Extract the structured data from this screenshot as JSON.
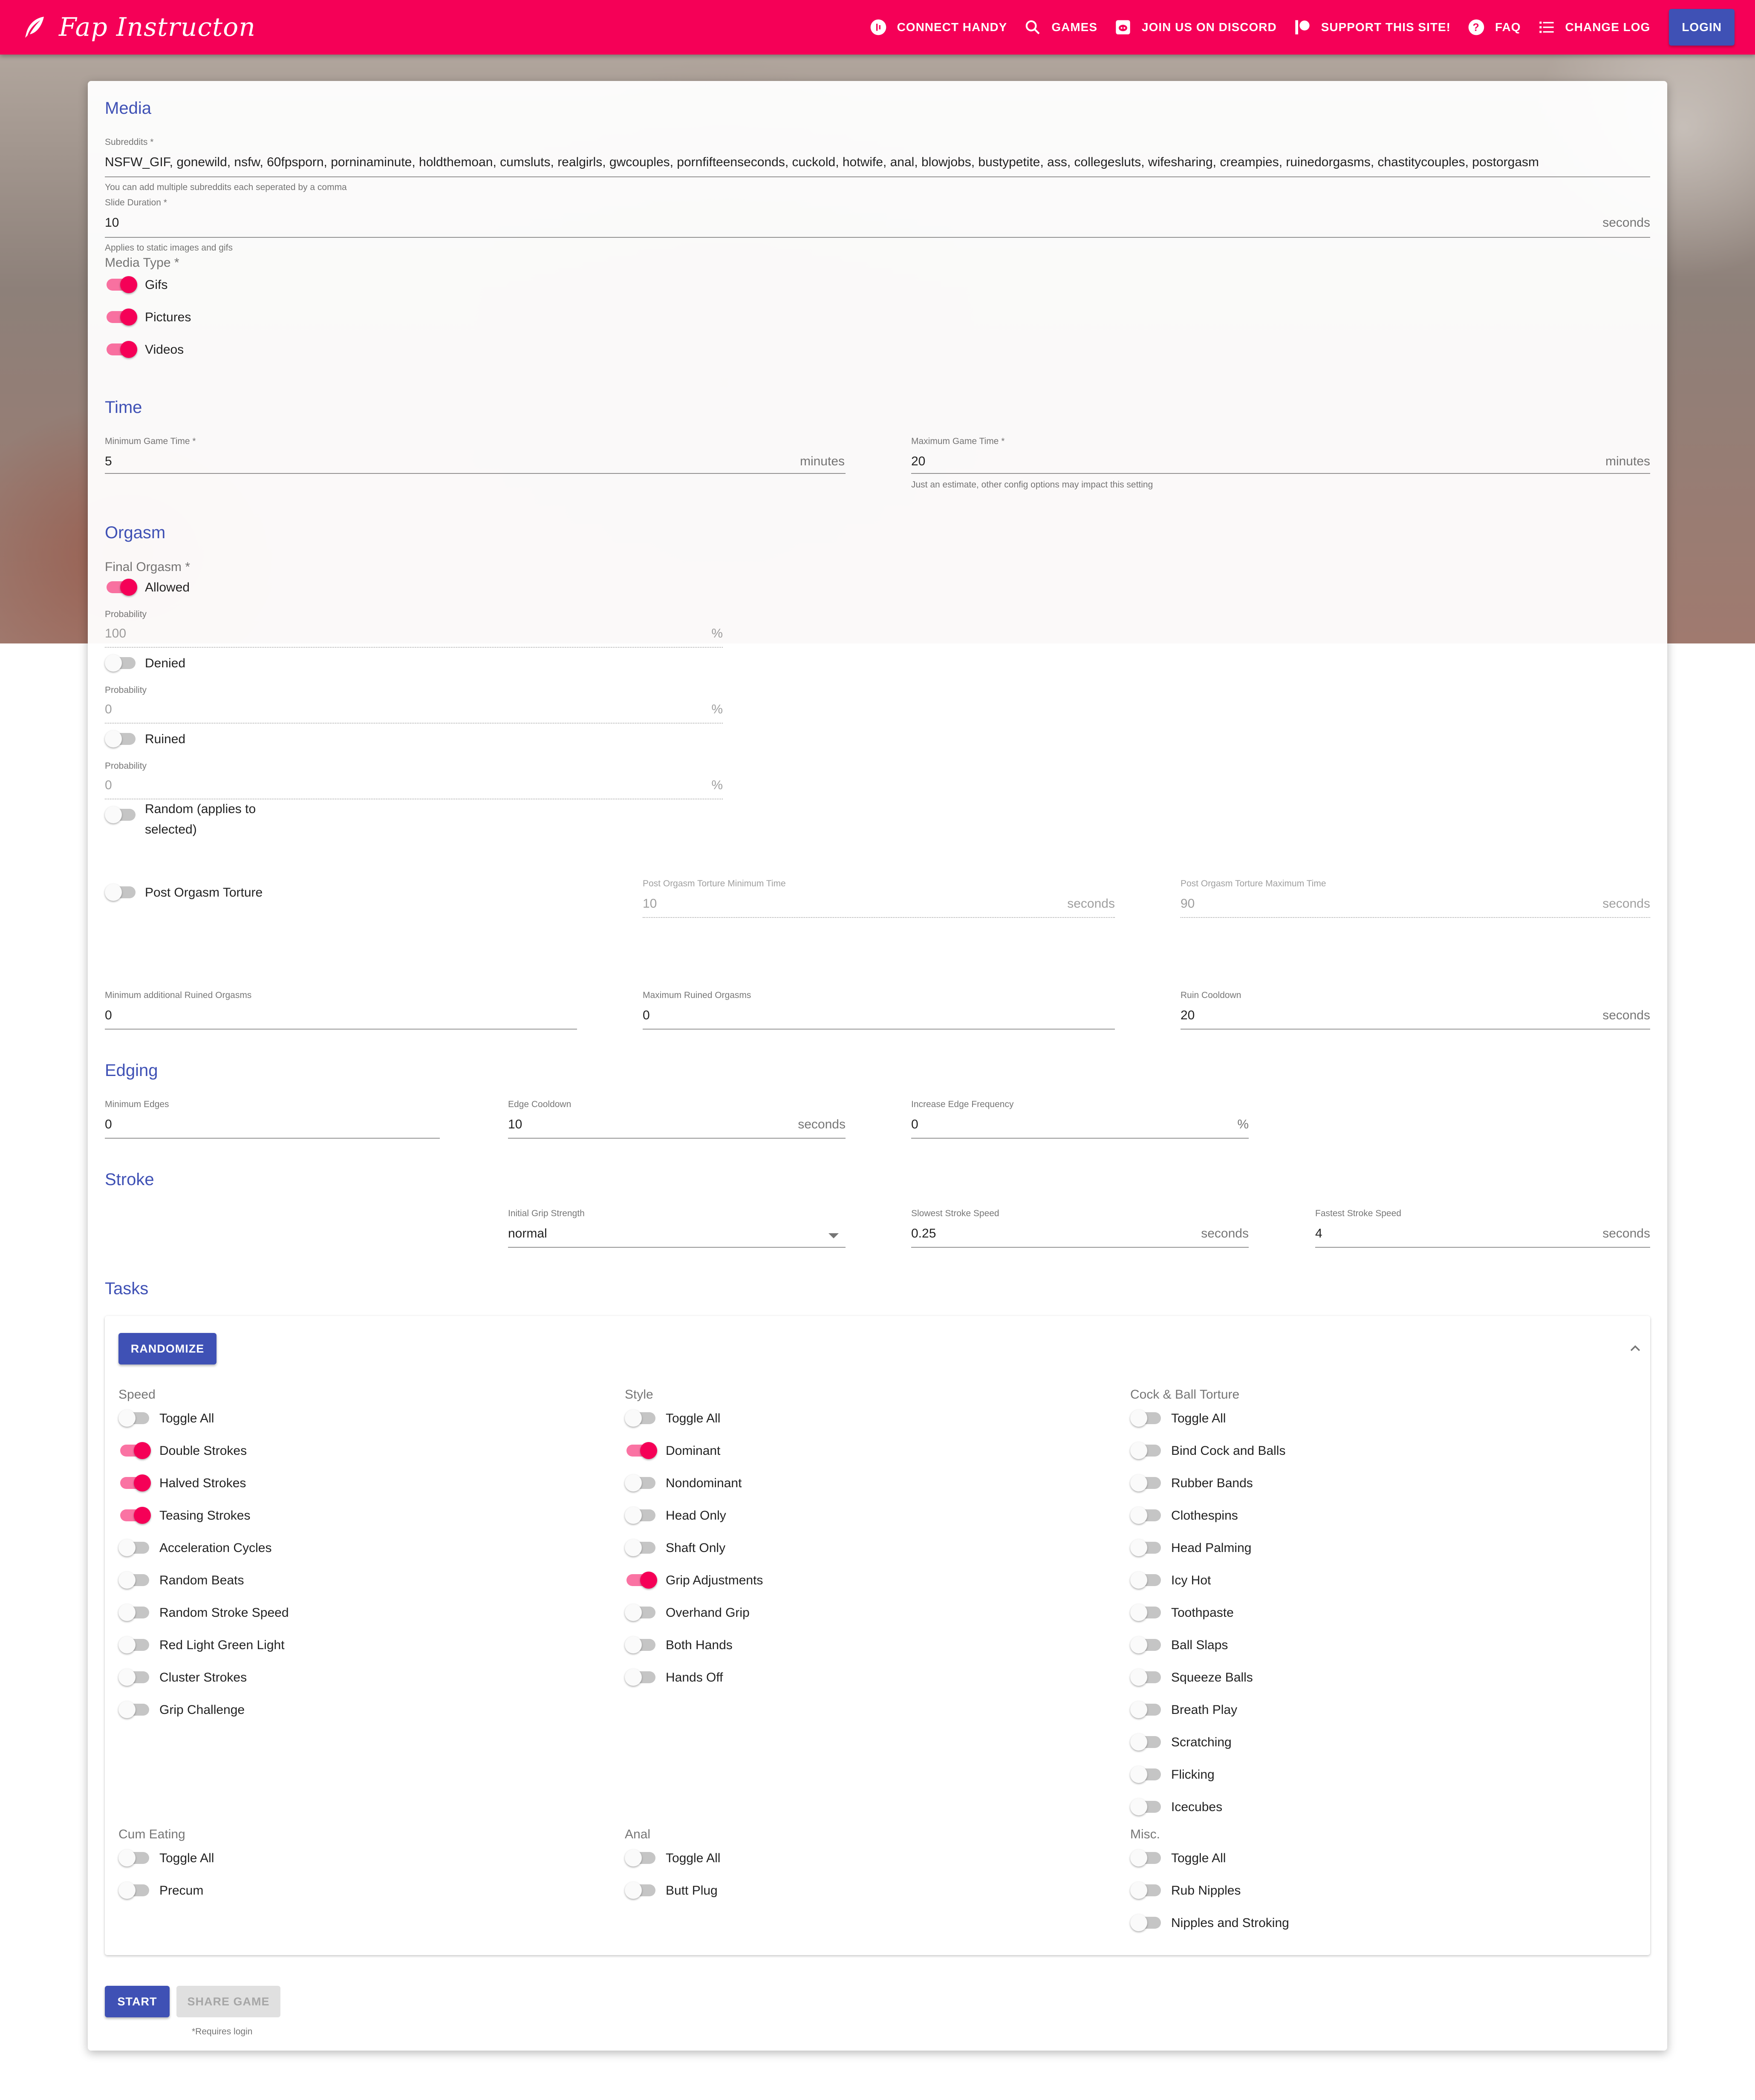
{
  "header": {
    "app_title": "Fap Instructon",
    "nav": [
      {
        "label": "CONNECT HANDY",
        "icon": "handy-icon"
      },
      {
        "label": "GAMES",
        "icon": "search-icon"
      },
      {
        "label": "JOIN US ON DISCORD",
        "icon": "discord-icon"
      },
      {
        "label": "SUPPORT THIS SITE!",
        "icon": "patreon-icon"
      },
      {
        "label": "FAQ",
        "icon": "help-icon"
      },
      {
        "label": "CHANGE LOG",
        "icon": "list-icon"
      }
    ],
    "login_label": "LOGIN"
  },
  "colors": {
    "primary": "#3f51b5",
    "accent": "#f50057"
  },
  "media": {
    "title": "Media",
    "subreddits_label": "Subreddits *",
    "subreddits_value": "NSFW_GIF, gonewild, nsfw, 60fpsporn, porninaminute, holdthemoan, cumsluts, realgirls, gwcouples, pornfifteenseconds, cuckold, hotwife, anal, blowjobs, bustypetite, ass, collegesluts, wifesharing, creampies, ruinedorgasms, chastitycouples, postorgasm",
    "subreddits_helper": "You can add multiple subreddits each seperated by a comma",
    "slide_label": "Slide Duration *",
    "slide_value": "10",
    "slide_unit": "seconds",
    "slide_helper": "Applies to static images and gifs",
    "type_label": "Media Type *",
    "types": [
      {
        "label": "Gifs",
        "on": true
      },
      {
        "label": "Pictures",
        "on": true
      },
      {
        "label": "Videos",
        "on": true
      }
    ]
  },
  "time": {
    "title": "Time",
    "min_label": "Minimum Game Time *",
    "min_value": "5",
    "min_unit": "minutes",
    "max_label": "Maximum Game Time *",
    "max_value": "20",
    "max_unit": "minutes",
    "max_helper": "Just an estimate, other config options may impact this setting"
  },
  "orgasm": {
    "title": "Orgasm",
    "final_label": "Final Orgasm *",
    "allowed_label": "Allowed",
    "allowed_on": true,
    "probability_label": "Probability",
    "allowed_prob": "100",
    "percent": "%",
    "denied_label": "Denied",
    "denied_on": false,
    "denied_prob": "0",
    "ruined_label": "Ruined",
    "ruined_on": false,
    "ruined_prob": "0",
    "random_label_1": "Random (applies to",
    "random_label_2": "selected)",
    "random_on": false,
    "pot_label": "Post Orgasm Torture",
    "pot_on": false,
    "pot_min_label": "Post Orgasm Torture Minimum Time",
    "pot_min_value": "10",
    "pot_min_unit": "seconds",
    "pot_max_label": "Post Orgasm Torture Maximum Time",
    "pot_max_value": "90",
    "pot_max_unit": "seconds",
    "min_ruined_label": "Minimum additional Ruined Orgasms",
    "min_ruined_value": "0",
    "max_ruined_label": "Maximum Ruined Orgasms",
    "max_ruined_value": "0",
    "ruin_cd_label": "Ruin Cooldown",
    "ruin_cd_value": "20",
    "ruin_cd_unit": "seconds"
  },
  "edging": {
    "title": "Edging",
    "min_label": "Minimum Edges",
    "min_value": "0",
    "cd_label": "Edge Cooldown",
    "cd_value": "10",
    "cd_unit": "seconds",
    "freq_label": "Increase Edge Frequency",
    "freq_value": "0",
    "freq_unit": "%"
  },
  "stroke": {
    "title": "Stroke",
    "grip_label": "Initial Grip Strength",
    "grip_value": "normal",
    "slow_label": "Slowest Stroke Speed",
    "slow_value": "0.25",
    "slow_unit": "seconds",
    "fast_label": "Fastest Stroke Speed",
    "fast_value": "4",
    "fast_unit": "seconds"
  },
  "tasks": {
    "title": "Tasks",
    "randomize_label": "RANDOMIZE",
    "groups": [
      {
        "title": "Speed",
        "items": [
          {
            "label": "Toggle All",
            "on": false
          },
          {
            "label": "Double Strokes",
            "on": true
          },
          {
            "label": "Halved Strokes",
            "on": true
          },
          {
            "label": "Teasing Strokes",
            "on": true
          },
          {
            "label": "Acceleration Cycles",
            "on": false
          },
          {
            "label": "Random Beats",
            "on": false
          },
          {
            "label": "Random Stroke Speed",
            "on": false
          },
          {
            "label": "Red Light Green Light",
            "on": false
          },
          {
            "label": "Cluster Strokes",
            "on": false
          },
          {
            "label": "Grip Challenge",
            "on": false
          }
        ]
      },
      {
        "title": "Style",
        "items": [
          {
            "label": "Toggle All",
            "on": false
          },
          {
            "label": "Dominant",
            "on": true
          },
          {
            "label": "Nondominant",
            "on": false
          },
          {
            "label": "Head Only",
            "on": false
          },
          {
            "label": "Shaft Only",
            "on": false
          },
          {
            "label": "Grip Adjustments",
            "on": true
          },
          {
            "label": "Overhand Grip",
            "on": false
          },
          {
            "label": "Both Hands",
            "on": false
          },
          {
            "label": "Hands Off",
            "on": false
          }
        ]
      },
      {
        "title": "Cock & Ball Torture",
        "items": [
          {
            "label": "Toggle All",
            "on": false
          },
          {
            "label": "Bind Cock and Balls",
            "on": false
          },
          {
            "label": "Rubber Bands",
            "on": false
          },
          {
            "label": "Clothespins",
            "on": false
          },
          {
            "label": "Head Palming",
            "on": false
          },
          {
            "label": "Icy Hot",
            "on": false
          },
          {
            "label": "Toothpaste",
            "on": false
          },
          {
            "label": "Ball Slaps",
            "on": false
          },
          {
            "label": "Squeeze Balls",
            "on": false
          },
          {
            "label": "Breath Play",
            "on": false
          },
          {
            "label": "Scratching",
            "on": false
          },
          {
            "label": "Flicking",
            "on": false
          },
          {
            "label": "Icecubes",
            "on": false
          }
        ]
      },
      {
        "title": "Cum Eating",
        "items": [
          {
            "label": "Toggle All",
            "on": false
          },
          {
            "label": "Precum",
            "on": false
          }
        ]
      },
      {
        "title": "Anal",
        "items": [
          {
            "label": "Toggle All",
            "on": false
          },
          {
            "label": "Butt Plug",
            "on": false
          }
        ]
      },
      {
        "title": "Misc.",
        "items": [
          {
            "label": "Toggle All",
            "on": false
          },
          {
            "label": "Rub Nipples",
            "on": false
          },
          {
            "label": "Nipples and Stroking",
            "on": false
          }
        ]
      }
    ]
  },
  "footer": {
    "start_label": "START",
    "share_label": "SHARE GAME",
    "requires_login": "*Requires login"
  }
}
